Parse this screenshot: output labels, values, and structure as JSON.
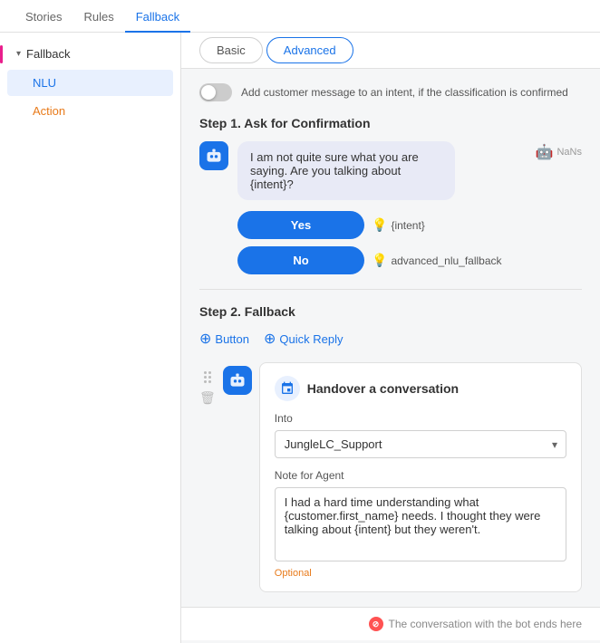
{
  "nav": {
    "items": [
      {
        "id": "stories",
        "label": "Stories"
      },
      {
        "id": "rules",
        "label": "Rules"
      },
      {
        "id": "fallback",
        "label": "Fallback",
        "active": true
      }
    ]
  },
  "sidebar": {
    "section_label": "Fallback",
    "items": [
      {
        "id": "nlu",
        "label": "NLU",
        "active": true
      },
      {
        "id": "action",
        "label": "Action",
        "active": false
      }
    ]
  },
  "tabs": {
    "basic": "Basic",
    "advanced": "Advanced",
    "active": "advanced"
  },
  "toggle": {
    "label": "Add customer message to an intent, if the classification is confirmed",
    "enabled": false
  },
  "step1": {
    "title": "Step 1. Ask for Confirmation",
    "bot_message": "I am not quite sure what you are saying. Are you talking about {intent}?",
    "nans": "NaNs",
    "yes_button": "Yes",
    "no_button": "No",
    "yes_intent": "{intent}",
    "no_intent": "advanced_nlu_fallback"
  },
  "step2": {
    "title": "Step 2. Fallback",
    "add_button": "Button",
    "add_quick_reply": "Quick Reply"
  },
  "handover": {
    "title": "Handover a conversation",
    "into_label": "Into",
    "into_value": "JungleLC_Support",
    "note_label": "Note for Agent",
    "note_text": "I had a hard time understanding what {customer.first_name} needs. I thought they were talking about {intent} but they weren't.",
    "note_placeholder": "Optional",
    "customer_var": "{customer.first_name}"
  },
  "footer": {
    "notice": "The conversation with the bot ends here"
  }
}
